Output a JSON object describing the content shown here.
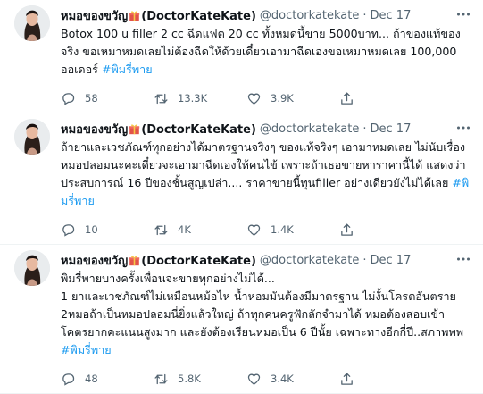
{
  "tweets": [
    {
      "name": "หมอของขวัญ",
      "name_suffix": "(DoctorKateKate)",
      "handle": "@doctorkatekate",
      "separator": "·",
      "date": "Dec 17",
      "text": "Botox 100 u filler 2 cc ฉีดแฟต 20 cc ทั้งหมดนี้ขาย 5000บาท... ถ้าของแท้ของจริง ขอเหมาหมดเลยไม่ต้องฉีดให้ด้วยเดี๋ยวเอามาฉีดเองขอเหมาหมดเลย 100,000 ออเดอร์ ",
      "hashtag": "#พิมรี่พาย",
      "replies": "58",
      "retweets": "13.3K",
      "likes": "3.9K"
    },
    {
      "name": "หมอของขวัญ",
      "name_suffix": "(DoctorKateKate)",
      "handle": "@doctorkatekate",
      "separator": "·",
      "date": "Dec 17",
      "text": "ถ้ายาและเวชภัณฑ์ทุกอย่างได้มาตรฐานจริงๆ ของแท้จริงๆ เอามาหมดเลย ไม่นับเรื่องหมอปลอมนะคะเดี๋ยวจะเอามาฉีดเองให้คนไข้ เพราะถ้าเธอขายหาราคานี้ได้ แสดงว่าประสบการณ์ 16 ปีของชั้นสูญเปล่า.... ราคาขายนี้ทุนfiller อย่างเดียวยังไม่ได้เลย ",
      "hashtag": "#พิมรี่พาย",
      "replies": "10",
      "retweets": "4K",
      "likes": "1.4K"
    },
    {
      "name": "หมอของขวัญ",
      "name_suffix": "(DoctorKateKate)",
      "handle": "@doctorkatekate",
      "separator": "·",
      "date": "Dec 17",
      "text": "พิมรี่พายบางครั้งเพื่อนจะขายทุกอย่างไม่ได้...\n1 ยาและเวชภัณฑ์ไม่เหมือนหม้อไห น้ำหอมมันต้องมีมาตรฐาน ไม่งั้นโครตอันตราย\n2หมอถ้าเป็นหมอปลอมนี่ยิ่งแล้วใหญ่ ถ้าทุกคนครูฟักลักจำมาได้ หมอต้องสอบเข้าโคตรยากคะแนนสูงมาก และยังต้องเรียนหมอเป็น 6 ปีนั้ย  เฉพาะทางอีกกี่ปี..สภาพพพ ",
      "hashtag": "#พิมรี่พาย",
      "replies": "48",
      "retweets": "5.8K",
      "likes": "3.4K"
    }
  ]
}
